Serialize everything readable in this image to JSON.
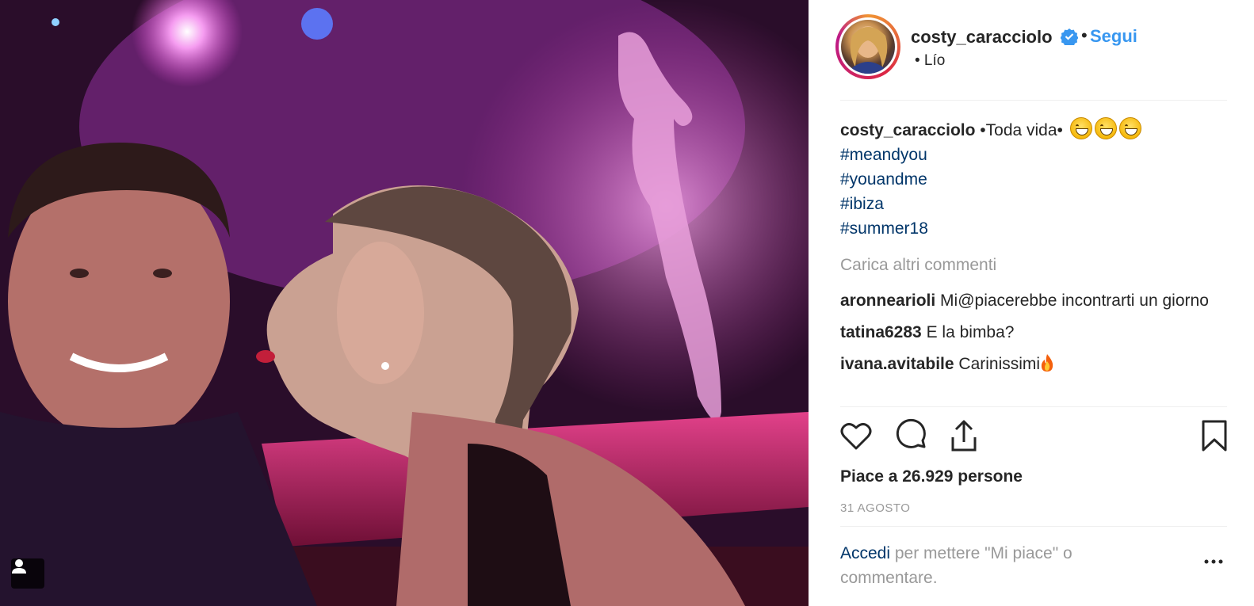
{
  "post": {
    "author": "costy_caracciolo",
    "verified_icon": "verified-badge-icon",
    "separator": "•",
    "follow_label": "Segui",
    "location": "• Lío",
    "caption_text": "•Toda vida•",
    "hashtags": [
      "#meandyou",
      "#youandme",
      "#ibiza",
      "#summer18"
    ],
    "load_more": "Carica altri commenti",
    "comments": [
      {
        "user": "aronnearioli",
        "text": "Mi@piacerebbe incontrarti un giorno"
      },
      {
        "user": "tatina6283",
        "text": "E la bimba?"
      },
      {
        "user": "ivana.avitabile",
        "text": "Carinissimi"
      }
    ],
    "likes": "Piace a 26.929 persone",
    "date": "31 AGOSTO",
    "login_link": "Accedi",
    "login_rest": " per mettere \"Mi piace\" o commentare."
  },
  "colors": {
    "link": "#003569",
    "follow": "#3897f0",
    "muted": "#999999",
    "text": "#262626"
  },
  "icons": {
    "like": "heart-icon",
    "comment": "comment-bubble-icon",
    "share": "share-icon",
    "save": "bookmark-icon",
    "more": "more-options-icon",
    "user_tag": "user-tag-icon"
  }
}
